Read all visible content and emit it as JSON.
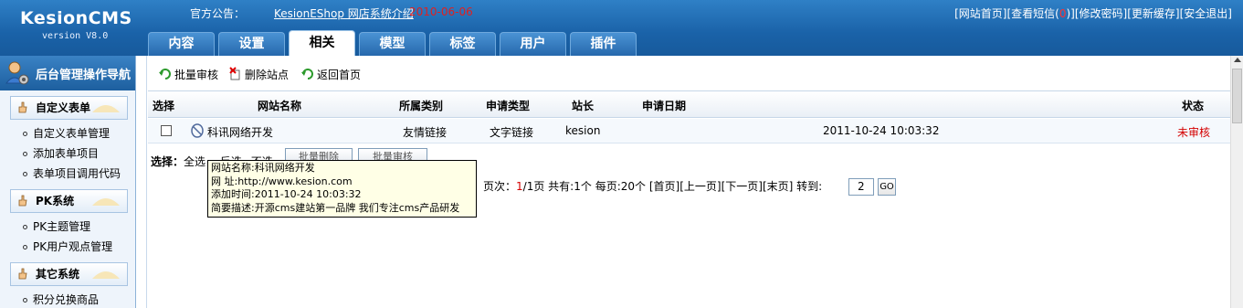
{
  "header": {
    "logo_title": "KesionCMS",
    "logo_version": "version V8.0",
    "notice_label": "官方公告：",
    "notice_link": "KesionEShop 网店系统介绍",
    "notice_date": "2010-06-06",
    "links": [
      "[网站首页]",
      "[查看短信(",
      ")]",
      "[修改密码]",
      "[更新缓存]",
      "[安全退出]"
    ],
    "message_count": "0"
  },
  "tabs": [
    {
      "label": "内容",
      "active": false
    },
    {
      "label": "设置",
      "active": false
    },
    {
      "label": "相关",
      "active": true
    },
    {
      "label": "模型",
      "active": false
    },
    {
      "label": "标签",
      "active": false
    },
    {
      "label": "用户",
      "active": false
    },
    {
      "label": "插件",
      "active": false
    }
  ],
  "sidebar": {
    "header": "后台管理操作导航",
    "sections": [
      {
        "title": "自定义表单",
        "items": [
          "自定义表单管理",
          "添加表单项目",
          "表单项目调用代码"
        ]
      },
      {
        "title": "PK系统",
        "items": [
          "PK主题管理",
          "PK用户观点管理"
        ]
      },
      {
        "title": "其它系统",
        "items": [
          "积分兑换商品"
        ]
      }
    ]
  },
  "toolbar": {
    "batch_review": "批量审核",
    "delete_site": "删除站点",
    "back_home": "返回首页"
  },
  "table": {
    "headers": [
      "选择",
      "网站名称",
      "所属类别",
      "申请类型",
      "站长",
      "申请日期",
      "状态"
    ],
    "rows": [
      {
        "name": "科讯网络开发",
        "category": "友情链接",
        "type": "文字链接",
        "owner": "kesion",
        "date": "2011-10-24 10:03:32",
        "status": "未审核"
      }
    ]
  },
  "selection": {
    "label": "选择：",
    "all": "全选",
    "invert": "反选",
    "none": "不选",
    "batch_delete": "批量删除",
    "batch_review": "批量审核"
  },
  "pager": {
    "prefix": "页次：",
    "current": "1",
    "total_pages": "/1页",
    "total": "共有:1个",
    "per_page": "每页:20个",
    "first": "[首页]",
    "prev": "[上一页]",
    "next": "[下一页]",
    "last": "[末页]",
    "goto_label": "转到:",
    "goto_value": "2",
    "go": "GO"
  },
  "tooltip": {
    "lines": [
      "网站名称:科讯网络开发",
      "网 址:http://www.kesion.com",
      "添加时间:2011-10-24 10:03:32",
      "简要描述:开源cms建站第一品牌 我们专注cms产品研发"
    ]
  },
  "colors": {
    "header_blue": "#1d65ab",
    "status_red": "#d40000"
  }
}
